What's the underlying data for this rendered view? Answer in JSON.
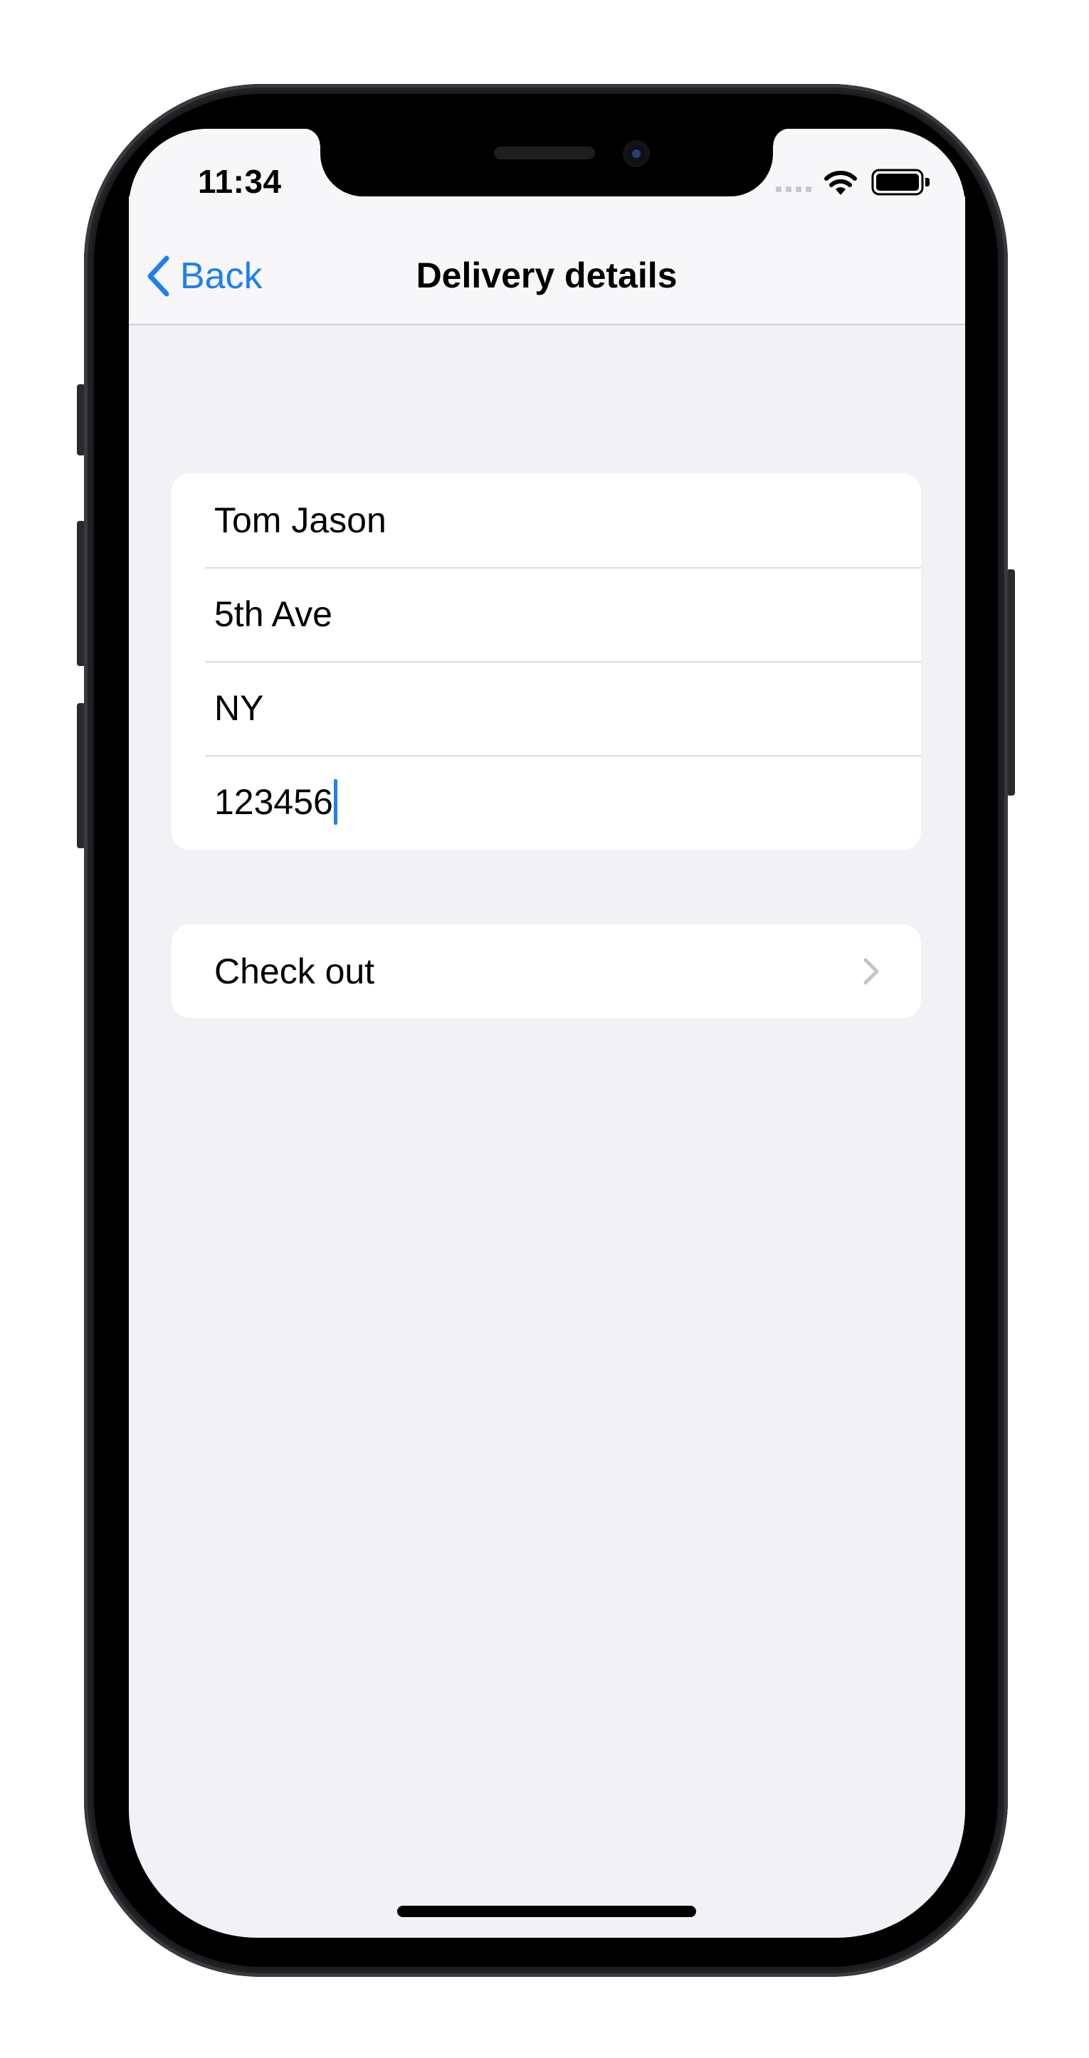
{
  "status_bar": {
    "time": "11:34",
    "icons": [
      "signal-dots-icon",
      "wifi-icon",
      "battery-icon"
    ]
  },
  "nav": {
    "back_label": "Back",
    "title": "Delivery details",
    "accent_color": "#1f7ff0"
  },
  "form": {
    "fields": [
      {
        "value": "Tom Jason"
      },
      {
        "value": "5th Ave"
      },
      {
        "value": "NY"
      },
      {
        "value": "123456",
        "focused": true
      }
    ]
  },
  "checkout": {
    "label": "Check out",
    "icon": "chevron-right-icon"
  },
  "colors": {
    "background": "#f1f1f6",
    "card": "#ffffff",
    "separator": "#dcdce0"
  }
}
